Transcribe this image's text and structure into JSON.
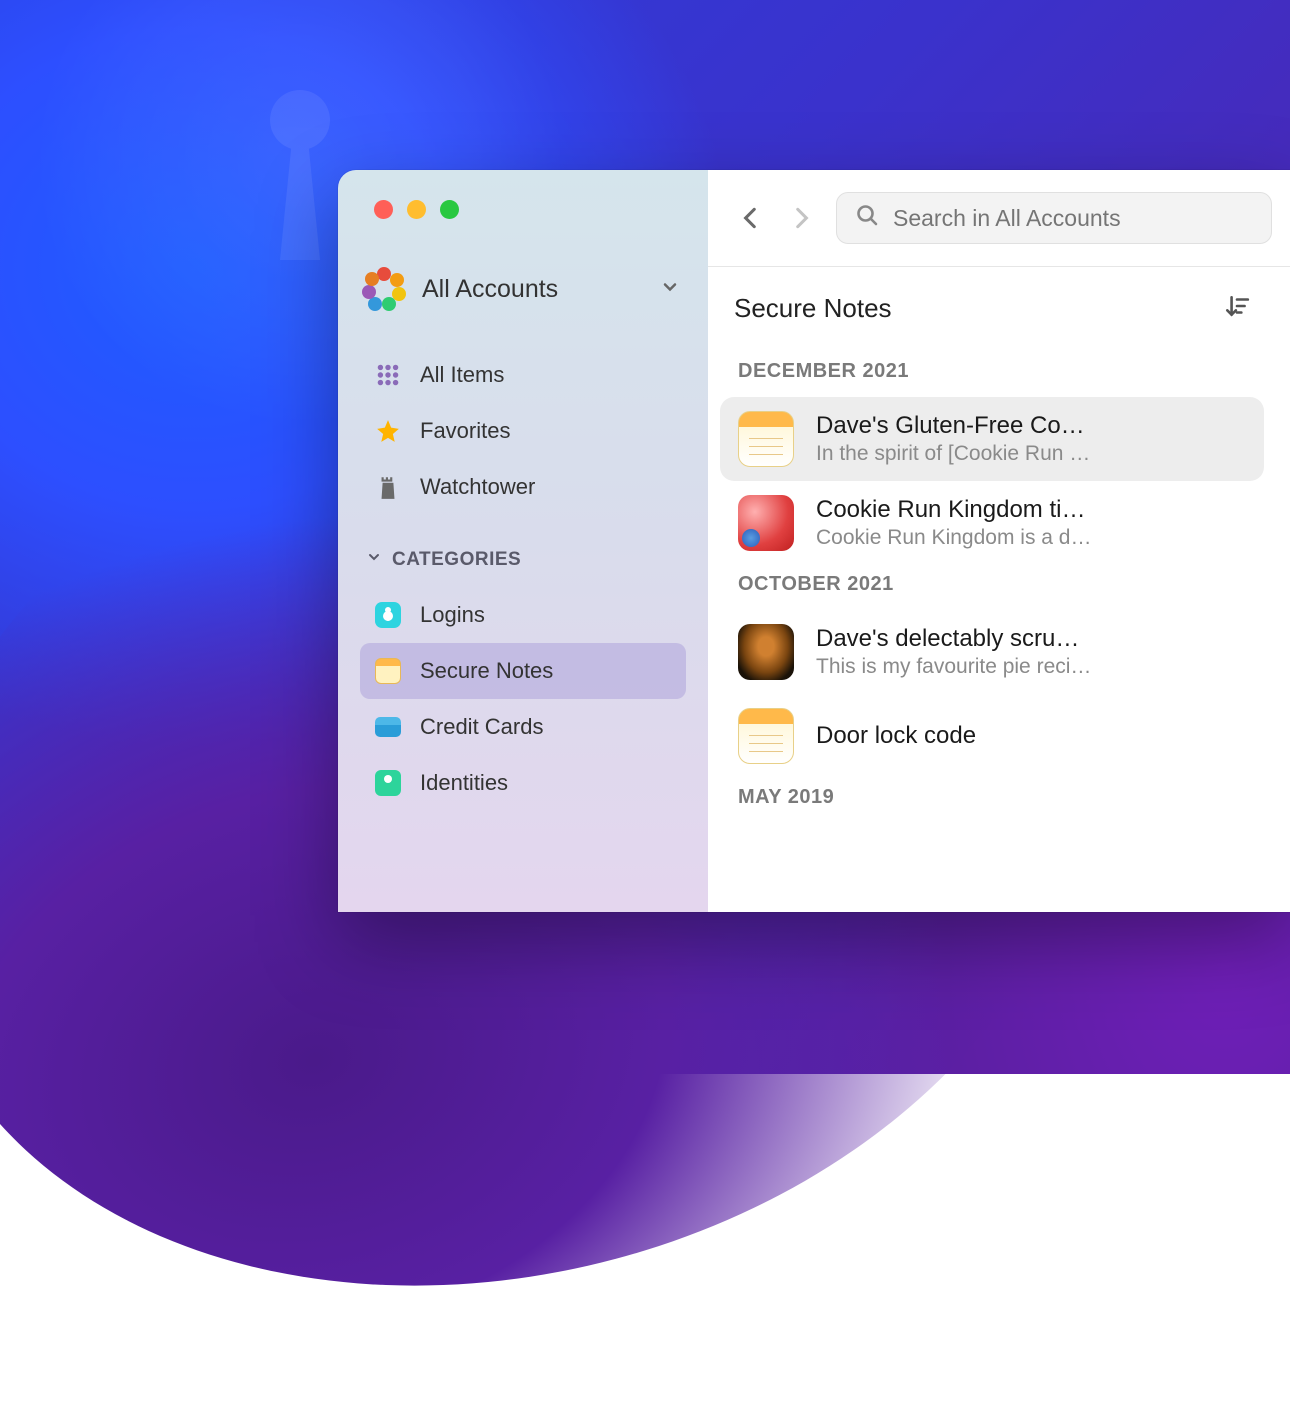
{
  "sidebar": {
    "account_label": "All Accounts",
    "nav": {
      "all_items": "All Items",
      "favorites": "Favorites",
      "watchtower": "Watchtower"
    },
    "categories_header": "CATEGORIES",
    "categories": {
      "logins": "Logins",
      "secure_notes": "Secure Notes",
      "credit_cards": "Credit Cards",
      "identities": "Identities"
    }
  },
  "toolbar": {
    "search_placeholder": "Search in All Accounts"
  },
  "list": {
    "title": "Secure Notes",
    "groups": [
      {
        "label": "DECEMBER 2021",
        "items": [
          {
            "title": "Dave's Gluten-Free Co…",
            "subtitle": "In the spirit of [Cookie Run …",
            "icon": "note",
            "selected": true
          },
          {
            "title": "Cookie Run Kingdom ti…",
            "subtitle": "Cookie Run Kingdom is a d…",
            "icon": "cookie",
            "selected": false
          }
        ]
      },
      {
        "label": "OCTOBER 2021",
        "items": [
          {
            "title": "Dave's delectably scru…",
            "subtitle": "This is my favourite pie reci…",
            "icon": "pie",
            "selected": false
          },
          {
            "title": "Door lock code",
            "subtitle": "",
            "icon": "note",
            "selected": false
          }
        ]
      },
      {
        "label": "MAY 2019",
        "items": []
      }
    ]
  }
}
